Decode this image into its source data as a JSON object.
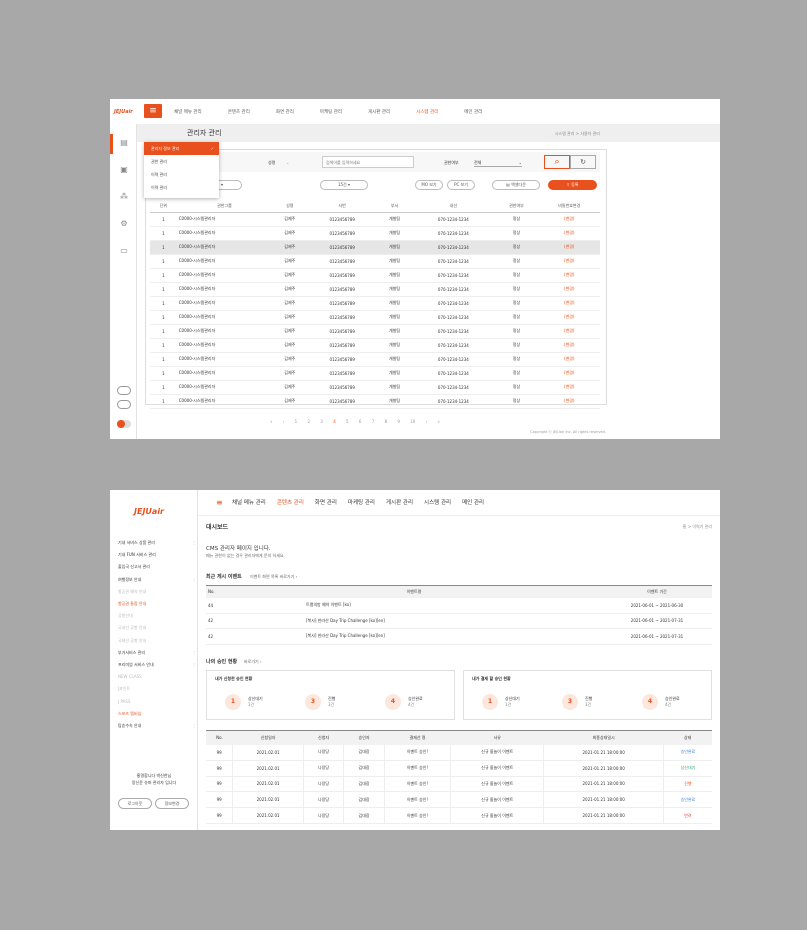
{
  "c1": {
    "logo": "JEJUair",
    "nav": [
      "채널 메뉴 관리",
      "콘텐츠 관리",
      "화면 관리",
      "마케팅 관리",
      "게시판 관리",
      "시스템 관리",
      "메인 관리"
    ],
    "page_title": "관리자 관리",
    "breadcrumb": "시스템 관리  >  사용자 관리",
    "dropdown": [
      "관리자 정보 관리",
      "권한 관리",
      "이력 관리",
      "이력 관리"
    ],
    "filter": {
      "f1": "성명",
      "f1_placeholder": "검색어를 입력하세요",
      "f2": "권한여부",
      "f2_val": "전체"
    },
    "chips": [
      "15건",
      "MO 보기",
      "PC 보기",
      "엑셀다운",
      "등록"
    ],
    "headers": [
      "단위",
      "권한그룹",
      "성명",
      "사번",
      "부서",
      "내선",
      "권한여부",
      "비밀번호변경"
    ],
    "row": {
      "c0": "1",
      "c1": "C0000-시스템관리자",
      "c2": "김제주",
      "c3": "0123456789",
      "c4": "개발팀",
      "c5": "070-1234-1234",
      "c6": "정상",
      "c7": "(변경)"
    },
    "pager": [
      "«",
      "‹",
      "1",
      "2",
      "3",
      "4",
      "5",
      "6",
      "7",
      "8",
      "9",
      "10",
      "›",
      "»"
    ],
    "copyright": "Copyright ⓒ JEJUair Inc. All rights reserved."
  },
  "c2": {
    "logo": "JEJUair",
    "nav": [
      "채널 메뉴 관리",
      "콘텐츠 관리",
      "화면 관리",
      "마케팅 관리",
      "게시판 관리",
      "시스템 관리",
      "메인 관리"
    ],
    "side": [
      "기내 서비스 상품 관리",
      "기내 FUN 서비스 관리",
      "출입국 신고서 관리",
      "여행정보 안내",
      "항공권 예약 안내",
      "항공권 통합 안내",
      "공항안내",
      "국내선 공항 안내",
      "국제선 공항 안내",
      "부가서비스 관리",
      "프리미엄 서비스 안내",
      "NEW CLASS",
      "J포인트",
      "J PASS",
      "스포츠 멤버십",
      "탑승수속 안내"
    ],
    "side_msg": [
      "홍명합니다 박신한님",
      "망신윤 슈퍼 관리자 입니다"
    ],
    "btns": [
      "로그아웃",
      "정보변경"
    ],
    "title": "대시보드",
    "crumb": "홈 > 이력기 관리",
    "welcome": "CMS 관리자 페이지 입니다.",
    "welcome2": "메뉴 권한이 없는 경우 관리자에게 문의 하세요.",
    "ev_title": "최근 게시 이벤트",
    "ev_link": "이벤트 화면 목록 바로가기 ›",
    "ev_head": [
      "No.",
      "이벤트명",
      "이벤트 기간"
    ],
    "ev_rows": [
      [
        "44",
        "트램의방 예약 이벤트 [ko]",
        "2021-06-01 ~ 2021-06-30"
      ],
      [
        "42",
        "[복사] 한라산 Day Trip Challenge [ko][en]",
        "2021-06-01 ~ 2021-07-31"
      ],
      [
        "42",
        "[복사] 한라산 Day Trip Challenge [ko][en]",
        "2021-06-01 ~ 2021-07-31"
      ]
    ],
    "ap_title": "나의 승인 현황",
    "ap_link": "바로가기 ›",
    "req_title": "내가 신청한 승인 현황",
    "res_title": "내가 결재 할 승인 현황",
    "stats": [
      {
        "n": "1",
        "l": "상신대기",
        "c": "1건"
      },
      {
        "n": "3",
        "l": "진행",
        "c": "3건"
      },
      {
        "n": "4",
        "l": "승인완료",
        "c": "4건"
      }
    ],
    "ap_head": [
      "No.",
      "신청일자",
      "신청자",
      "승인자",
      "결재선 명",
      "사유",
      "최종상태일시",
      "상태"
    ],
    "ap_rows": [
      [
        "99",
        "2021.02.01",
        "나랑당",
        "김대장",
        "이벤트 승인!",
        "신규 올놀이 이벤트",
        "2021-01.21 18:00:00",
        "승인완료"
      ],
      [
        "99",
        "2021.02.01",
        "나랑당",
        "김대장",
        "이벤트 승인!",
        "신규 올놀이 이벤트",
        "2021-01.21 18:00:00",
        "상신대기"
      ],
      [
        "99",
        "2021.02.01",
        "나랑당",
        "김대장",
        "이벤트 승인!",
        "신규 올놀이 이벤트",
        "2021-01.21 18:00:00",
        "진행"
      ],
      [
        "99",
        "2021.02.01",
        "나랑당",
        "김대장",
        "이벤트 승인!",
        "신규 올놀이 이벤트",
        "2021-01.21 18:00:00",
        "승인완료"
      ],
      [
        "99",
        "2021.02.01",
        "나랑당",
        "김대장",
        "이벤트 승인!",
        "신규 올놀이 이벤트",
        "2021-01.21 18:00:00",
        "반려"
      ]
    ],
    "status_colors": {
      "승인완료": "#3a7bd5",
      "상신대기": "#2aa876",
      "진행": "#e8501e",
      "반려": "#e83a3a"
    }
  }
}
